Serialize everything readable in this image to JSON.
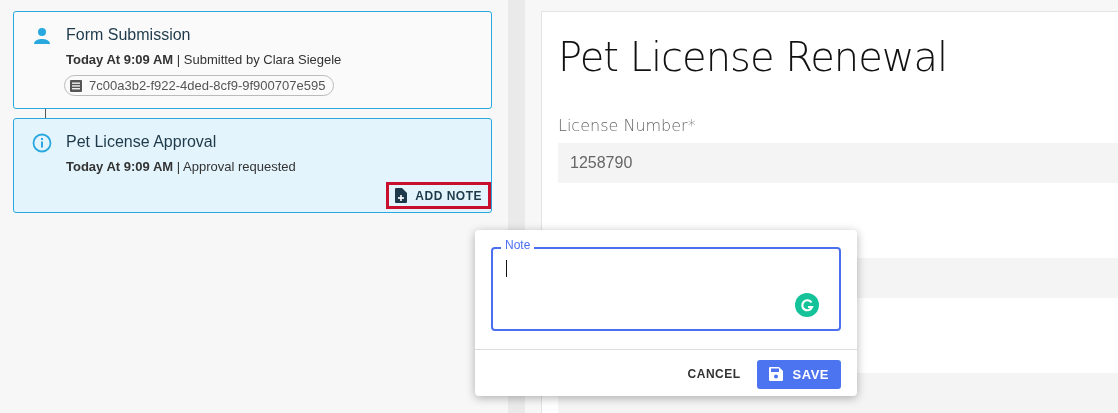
{
  "timeline": [
    {
      "kind": "person",
      "title": "Form Submission",
      "time": "Today At 9:09 AM",
      "separator": "|",
      "detail": "Submitted by Clara Siegele",
      "chip": "7c00a3b2-f922-4ded-8cf9-9f900707e595",
      "selected": false
    },
    {
      "kind": "info",
      "title": "Pet License Approval",
      "time": "Today At 9:09 AM",
      "separator": "|",
      "detail": "Approval requested",
      "action": {
        "label": "ADD NOTE",
        "outlined": true
      },
      "selected": true
    }
  ],
  "form": {
    "title": "Pet License Renewal",
    "fields": [
      {
        "kind": "text",
        "label": "License Number*",
        "value": "1258790"
      },
      {
        "kind": "empty"
      },
      {
        "kind": "empty"
      }
    ]
  },
  "note_dialog": {
    "label": "Note",
    "cancel": "CANCEL",
    "save": "SAVE"
  }
}
